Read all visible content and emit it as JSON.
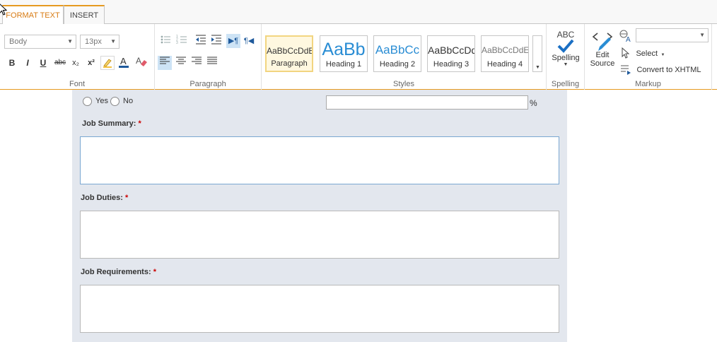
{
  "tabs": [
    {
      "label": "FORMAT TEXT",
      "active": true
    },
    {
      "label": "INSERT",
      "active": false
    }
  ],
  "ribbon": {
    "font": {
      "label": "Font",
      "font_name": "Body",
      "font_size": "13px",
      "buttons": {
        "bold": "B",
        "italic": "I",
        "underline": "U",
        "strike": "abc",
        "subscript": "x₂",
        "superscript": "x²"
      }
    },
    "paragraph": {
      "label": "Paragraph"
    },
    "styles": {
      "label": "Styles",
      "items": [
        {
          "sample": "AaBbCcDdE",
          "name": "Paragraph",
          "selected": true
        },
        {
          "sample": "AaBb",
          "name": "Heading 1"
        },
        {
          "sample": "AaBbCc",
          "name": "Heading 2"
        },
        {
          "sample": "AaBbCcDd",
          "name": "Heading 3"
        },
        {
          "sample": "AaBbCcDdE",
          "name": "Heading 4"
        }
      ]
    },
    "spelling": {
      "label": "Spelling",
      "button_label": "Spelling",
      "icon_text": "ABC"
    },
    "markup": {
      "label": "Markup",
      "edit_source_line1": "Edit",
      "edit_source_line2": "Source",
      "select_label": "Select",
      "convert_label": "Convert to XHTML",
      "language_value": ""
    }
  },
  "form": {
    "radio_yes": "Yes",
    "radio_no": "No",
    "percent_sign": "%",
    "percent_value": "",
    "fields": [
      {
        "label": "Job Summary:",
        "required": "*",
        "value": ""
      },
      {
        "label": "Job Duties:",
        "required": "*",
        "value": ""
      },
      {
        "label": "Job Requirements:",
        "required": "*",
        "value": ""
      }
    ]
  },
  "colors": {
    "accent": "#e69a20",
    "required": "#cc0000",
    "form_bg": "#e3e7ee",
    "spell_blue": "#1a6fc4"
  }
}
